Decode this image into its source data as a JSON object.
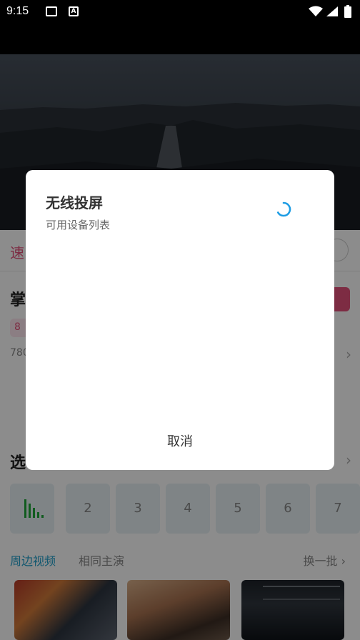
{
  "status_bar": {
    "time": "9:15",
    "icons": [
      "photo-icon",
      "text-a-icon",
      "wifi-icon",
      "signal-icon",
      "battery-icon"
    ]
  },
  "background": {
    "tab_label": "速",
    "title_fragment": "掌",
    "tag_fragment": "8",
    "views_fragment": "780",
    "section_fragment": "选",
    "episodes": [
      "2",
      "3",
      "4",
      "5",
      "6",
      "7"
    ],
    "related": {
      "tab_active": "周边视频",
      "tab_inactive": "相同主演",
      "refresh": "换一批"
    }
  },
  "dialog": {
    "title": "无线投屏",
    "subtitle": "可用设备列表",
    "cancel_label": "取消"
  },
  "colors": {
    "accent_pink": "#e4507a",
    "accent_blue": "#1f9fca",
    "spinner": "#1e9de4",
    "playing_bars": "#1fa83a"
  }
}
